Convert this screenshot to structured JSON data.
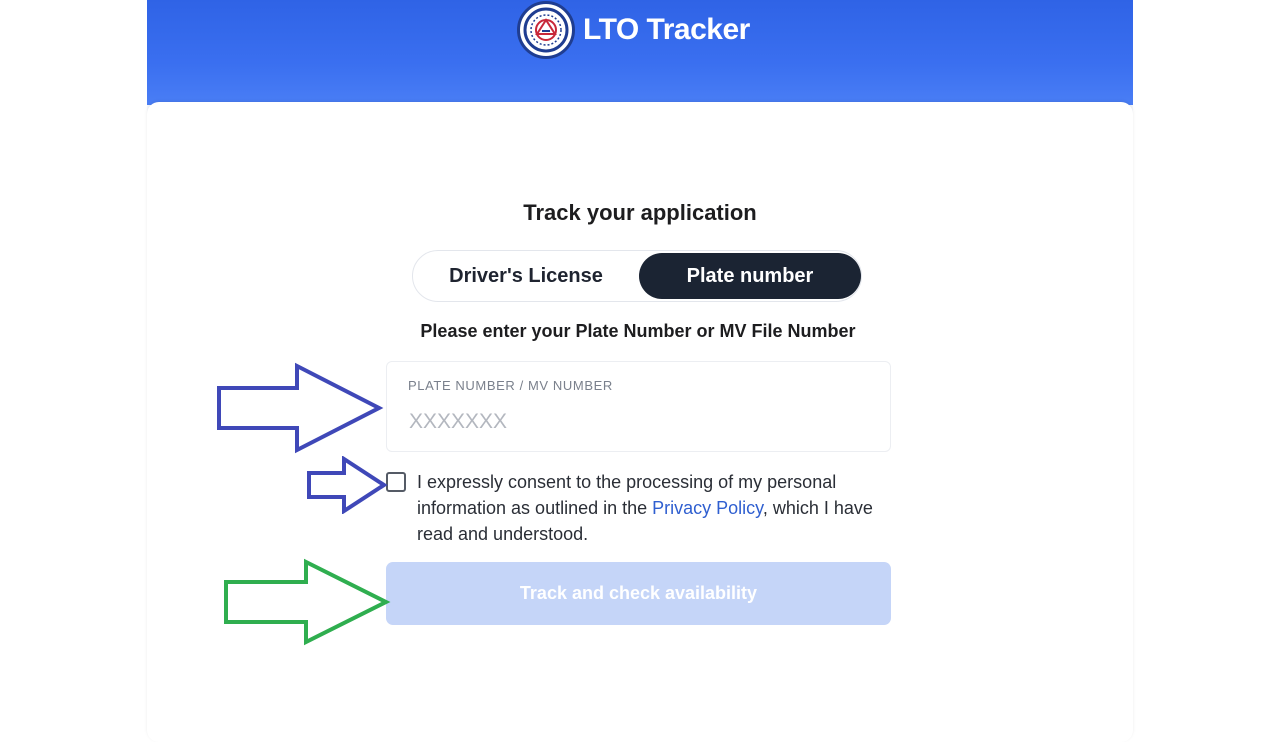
{
  "header": {
    "brand_name": "LTO Tracker",
    "logo_icon": "lto-seal-icon",
    "background_color": "#3a6ff0"
  },
  "form": {
    "title": "Track your application",
    "tabs": [
      {
        "label": "Driver's License",
        "selected": false
      },
      {
        "label": "Plate number",
        "selected": true
      }
    ],
    "instruction": "Please enter your Plate Number or MV File Number",
    "field": {
      "label": "PLATE NUMBER / MV NUMBER",
      "placeholder": "XXXXXXX",
      "value": ""
    },
    "consent": {
      "checked": false,
      "text_before": "I expressly consent to the processing of my personal information as outlined in the ",
      "link_text": "Privacy Policy",
      "text_after": ", which I have read and understood."
    },
    "submit_label": "Track and check availability",
    "submit_color": "#c5d5f8"
  },
  "annotations": {
    "arrow_colors": {
      "blue": "#3f48b8",
      "green": "#2fae4f"
    }
  }
}
